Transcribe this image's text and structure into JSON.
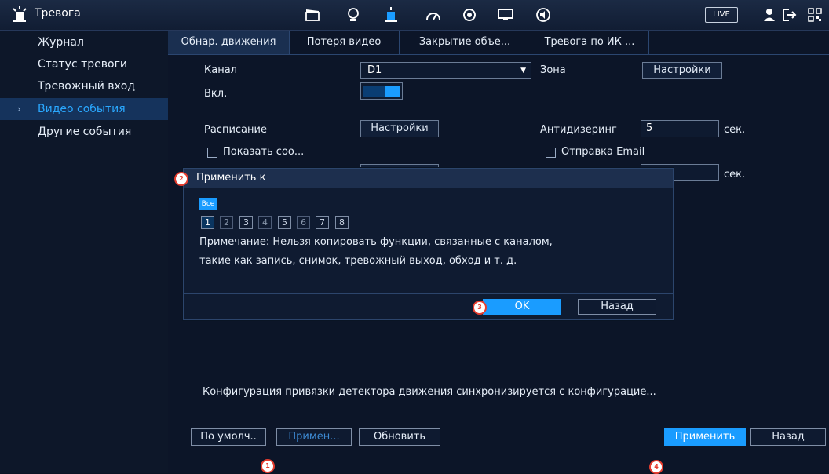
{
  "header": {
    "title": "Тревога",
    "live_label": "LIVE",
    "icons": [
      "video-clip-icon",
      "face-icon",
      "alarm-light-icon",
      "speed-gauge-icon",
      "circle-arrows-icon",
      "monitor-icon",
      "speaker-icon",
      "user-icon",
      "logout-icon",
      "qr-code-icon"
    ]
  },
  "sidebar": {
    "items": [
      {
        "label": "Журнал"
      },
      {
        "label": "Статус тревоги"
      },
      {
        "label": "Тревожный вход"
      },
      {
        "label": "Видео события",
        "active": true
      },
      {
        "label": "Другие события"
      }
    ]
  },
  "tabs": [
    {
      "label": "Обнар. движения",
      "active": true
    },
    {
      "label": "Потеря видео"
    },
    {
      "label": "Закрытие объе..."
    },
    {
      "label": "Тревога по ИК ..."
    }
  ],
  "form": {
    "channel_label": "Канал",
    "channel_value": "D1",
    "zone_label": "Зона",
    "zone_button": "Настройки",
    "enable_label": "Вкл.",
    "schedule_label": "Расписание",
    "schedule_button": "Настройки",
    "antidither_label": "Антидизеринг",
    "antidither_value": "5",
    "antidither_unit": "сек.",
    "show_msg_label": "Показать соо...",
    "send_email_label": "Отправка Email",
    "second_unit": "сек."
  },
  "dialog": {
    "title": "Применить к",
    "all_label": "Все",
    "channels": [
      "1",
      "2",
      "3",
      "4",
      "5",
      "6",
      "7",
      "8"
    ],
    "note_line1": "Примечание: Нельзя копировать функции, связанные с каналом,",
    "note_line2": "такие как запись, снимок, тревожный выход, обход и т. д.",
    "ok_label": "OK",
    "back_label": "Назад"
  },
  "footer": {
    "sync_note": "Конфигурация привязки детектора движения синхронизируется с конфигурацие...",
    "default_label": "По умолч..",
    "apply_to_label": "Примен...",
    "refresh_label": "Обновить",
    "apply_label": "Применить",
    "back_label": "Назад"
  },
  "badges": [
    "1",
    "2",
    "3",
    "4"
  ],
  "colors": {
    "accent": "#1a9cff",
    "background": "#0c1528",
    "badge_border": "#e63c2e"
  }
}
